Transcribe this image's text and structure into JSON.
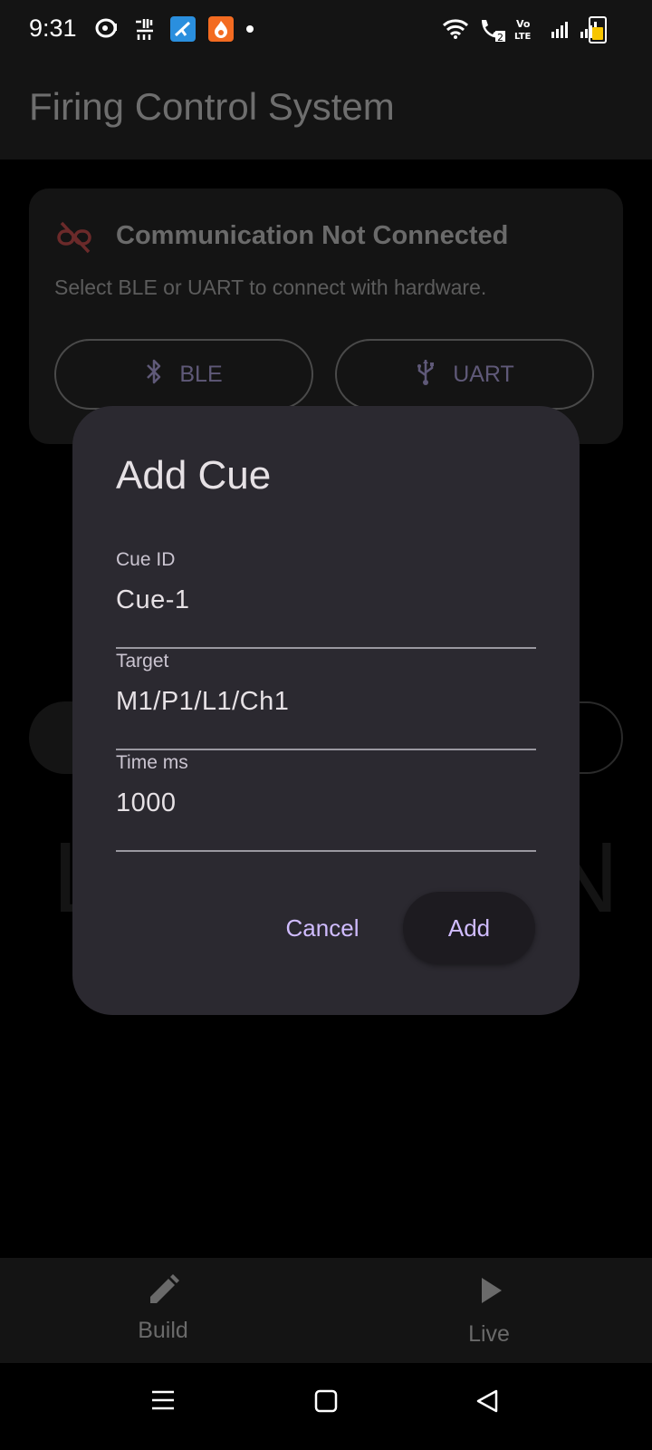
{
  "status_bar": {
    "time": "9:31",
    "left_icons": [
      "chat-bubble-icon",
      "urdu-sim-icon",
      "telenor-icon",
      "fire-app-icon",
      "notification-dot"
    ],
    "right_icons": [
      "wifi-icon",
      "wifi-call-icon",
      "volte-icon",
      "signal-icon",
      "signal-icon",
      "battery-charging-icon"
    ],
    "wifi_call_badge": "2",
    "volte_label": "Vo\nLTE"
  },
  "app_bar": {
    "title": "Firing Control System"
  },
  "connection_card": {
    "title": "Communication Not Connected",
    "description": "Select BLE or UART to connect with hardware.",
    "ble_label": "BLE",
    "uart_label": "UART",
    "icon": "link-off-icon"
  },
  "dialog": {
    "title": "Add Cue",
    "fields": [
      {
        "label": "Cue ID",
        "value": "Cue-1"
      },
      {
        "label": "Target",
        "value": "M1/P1/L1/Ch1"
      },
      {
        "label": "Time ms",
        "value": "1000"
      }
    ],
    "cancel_label": "Cancel",
    "add_label": "Add"
  },
  "bottom_nav": {
    "items": [
      {
        "label": "Build",
        "icon": "pencil-icon"
      },
      {
        "label": "Live",
        "icon": "play-icon"
      }
    ]
  },
  "background_glyphs": {
    "left": "L",
    "right": "N"
  },
  "colors": {
    "accent": "#d0bcff",
    "dialog_bg": "#2b2930",
    "surface": "#141414",
    "link_off": "#6b2a2a"
  }
}
